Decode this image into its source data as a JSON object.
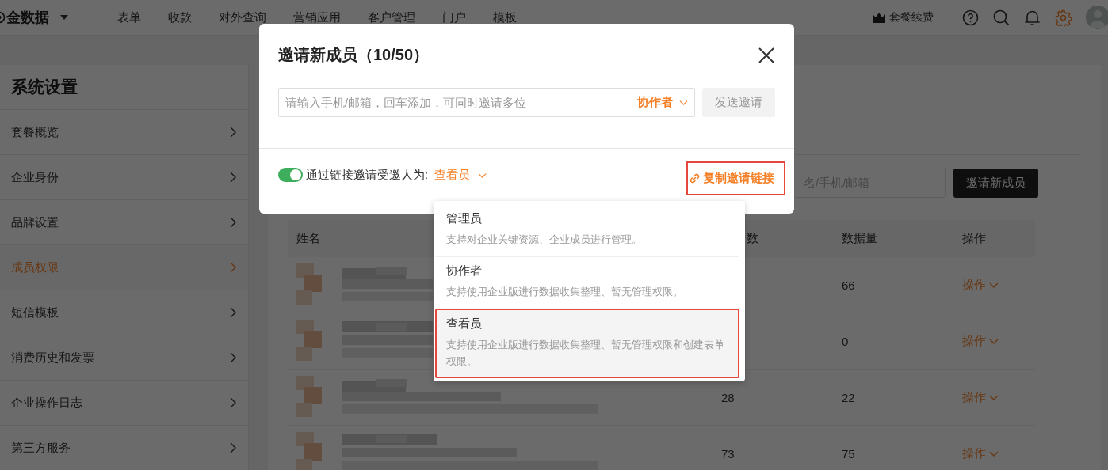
{
  "top_bar": {
    "logo": "金数据",
    "nav": [
      {
        "label": "表单"
      },
      {
        "label": "收款"
      },
      {
        "label": "对外查询"
      },
      {
        "label": "营销应用"
      },
      {
        "label": "客户管理"
      },
      {
        "label": "门户"
      },
      {
        "label": "模板"
      }
    ],
    "renew": "套餐续费"
  },
  "sidebar": {
    "title": "系统设置",
    "items": [
      {
        "label": "套餐概览",
        "selected": false
      },
      {
        "label": "企业身份",
        "selected": false
      },
      {
        "label": "品牌设置",
        "selected": false
      },
      {
        "label": "成员权限",
        "selected": true
      },
      {
        "label": "短信模板",
        "selected": false
      },
      {
        "label": "消费历史和发票",
        "selected": false
      },
      {
        "label": "企业操作日志",
        "selected": false
      },
      {
        "label": "第三方服务",
        "selected": false
      }
    ]
  },
  "members": {
    "search_placeholder": "名/手机/邮箱",
    "invite_button": "邀请新成员",
    "columns": [
      "姓名",
      "数",
      "数据量",
      "操作"
    ],
    "rows": [
      {
        "data_count": "66",
        "action": "操作"
      },
      {
        "data_count": "0",
        "action": "操作"
      },
      {
        "column_3": "28",
        "data_count": "22",
        "action": "操作"
      },
      {
        "column_3": "73",
        "data_count": "75",
        "action": "操作"
      }
    ]
  },
  "invite_dialog": {
    "title": "邀请新成员（10/50）",
    "input_placeholder": "请输入手机/邮箱，回车添加，可同时邀请多位",
    "role": "协作者",
    "send_button": "发送邀请",
    "link_invite": {
      "on": true,
      "label": "通过链接邀请受邀人为:",
      "role": "查看员"
    },
    "copy_link": {
      "label": "复制邀请链接",
      "highlighted": true
    }
  },
  "role_menu": [
    {
      "name": "管理员",
      "description": "支持对企业关键资源、企业成员进行管理。",
      "selected": false
    },
    {
      "name": "协作者",
      "description": "支持使用企业版进行数据收集整理、暂无管理权限。",
      "selected": false
    },
    {
      "name": "查看员",
      "description": "支持使用企业版进行数据收集整理、暂无管理权限和创建表单权限。",
      "selected": true
    }
  ]
}
